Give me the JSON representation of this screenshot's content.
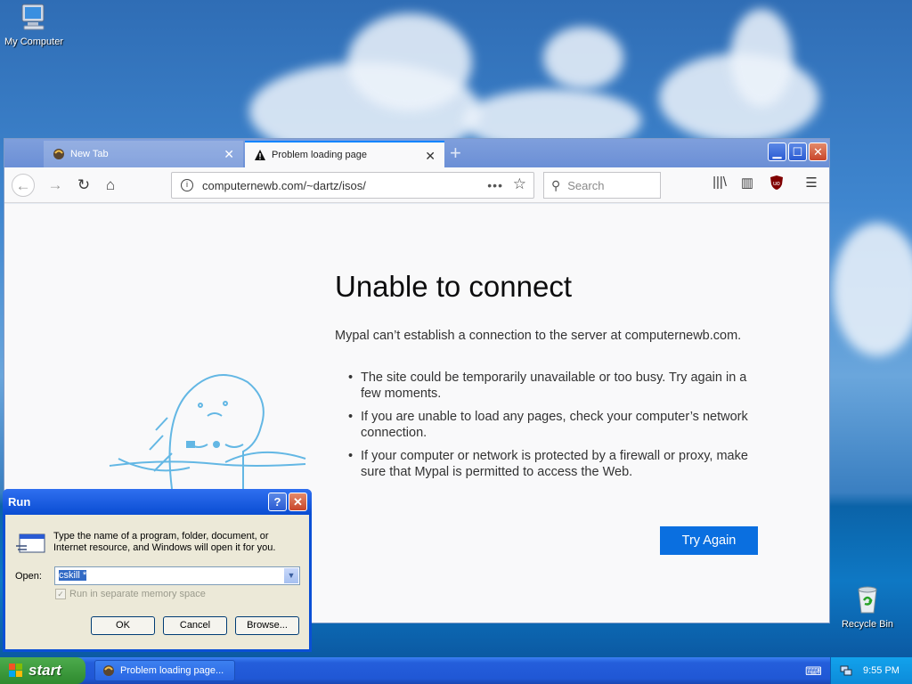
{
  "desktop": {
    "icons": [
      {
        "label": "My Computer",
        "icon": "my-computer-icon"
      },
      {
        "label": "Recycle Bin",
        "icon": "recycle-bin-icon"
      }
    ]
  },
  "browser": {
    "tabs": [
      {
        "label": "New Tab",
        "icon": "mypal-icon",
        "active": false
      },
      {
        "label": "Problem loading page",
        "icon": "warning-icon",
        "active": true
      }
    ],
    "new_tab": "+",
    "url": "computernewb.com/~dartz/isos/",
    "search_placeholder": "Search",
    "page": {
      "title": "Unable to connect",
      "description": "Mypal can’t establish a connection to the server at computernewb.com.",
      "bullets": [
        "The site could be temporarily unavailable or too busy. Try again in a few moments.",
        "If you are unable to load any pages, check your computer’s network connection.",
        "If your computer or network is protected by a firewall or proxy, make sure that Mypal is permitted to access the Web."
      ],
      "try_again": "Try Again"
    },
    "accent_color": "#0a6fe0"
  },
  "run_dialog": {
    "title": "Run",
    "help": "?",
    "close": "✕",
    "description": "Type the name of a program, folder, document, or Internet resource, and Windows will open it for you.",
    "open_label": "Open:",
    "open_value": "cskill *",
    "separate_memory": "Run in separate memory space",
    "ok": "OK",
    "cancel": "Cancel",
    "browse": "Browse..."
  },
  "taskbar": {
    "start": "start",
    "task": "Problem loading page...",
    "clock": "9:55 PM"
  }
}
